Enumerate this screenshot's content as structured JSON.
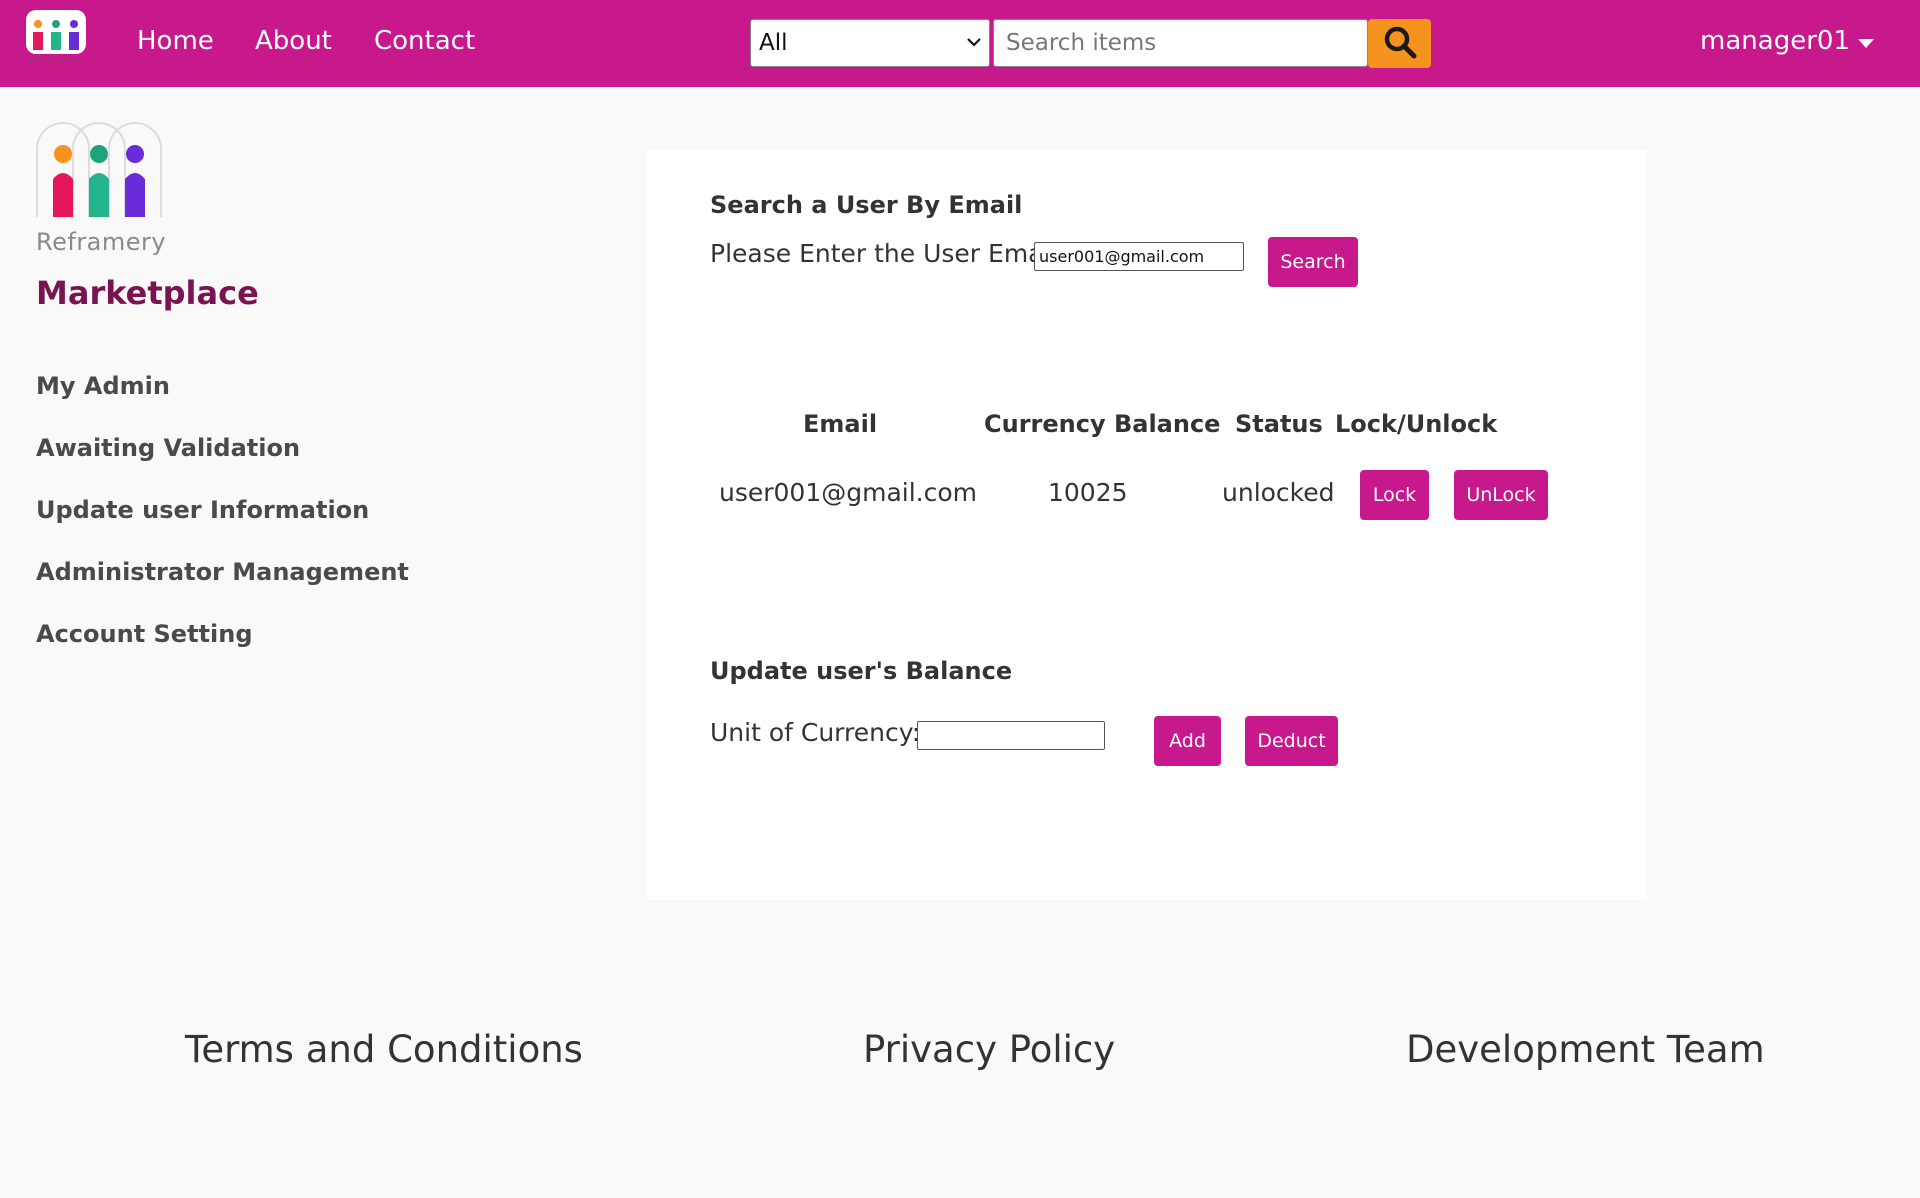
{
  "header": {
    "brand_small": "Reframery",
    "nav": {
      "home": "Home",
      "about": "About",
      "contact": "Contact"
    },
    "category_select": {
      "selected": "All"
    },
    "search": {
      "placeholder": "Search items"
    },
    "user": {
      "name": "manager01"
    },
    "colors": {
      "bar": "#c8198c",
      "search_button": "#f6931e"
    }
  },
  "sidebar": {
    "brand": "Reframery",
    "title": "Marketplace",
    "items": [
      {
        "label": "My Admin"
      },
      {
        "label": "Awaiting Validation"
      },
      {
        "label": "Update user Information"
      },
      {
        "label": "Administrator Management"
      },
      {
        "label": "Account Setting"
      }
    ]
  },
  "main": {
    "search_section": {
      "title": "Search a User By Email",
      "prompt": "Please Enter the User Email:",
      "email_value": "user001@gmail.com",
      "button": "Search"
    },
    "table": {
      "headers": {
        "email": "Email",
        "balance": "Currency Balance",
        "status": "Status",
        "lock": "Lock/Unlock"
      },
      "row": {
        "email": "user001@gmail.com",
        "balance": "10025",
        "status": "unlocked",
        "lock_button": "Lock",
        "unlock_button": "UnLock"
      }
    },
    "balance_section": {
      "title": "Update user's Balance",
      "label": "Unit of Currency:",
      "value": "",
      "add_button": "Add",
      "deduct_button": "Deduct"
    }
  },
  "footer": {
    "terms": "Terms and Conditions",
    "privacy": "Privacy Policy",
    "team": "Development Team"
  }
}
